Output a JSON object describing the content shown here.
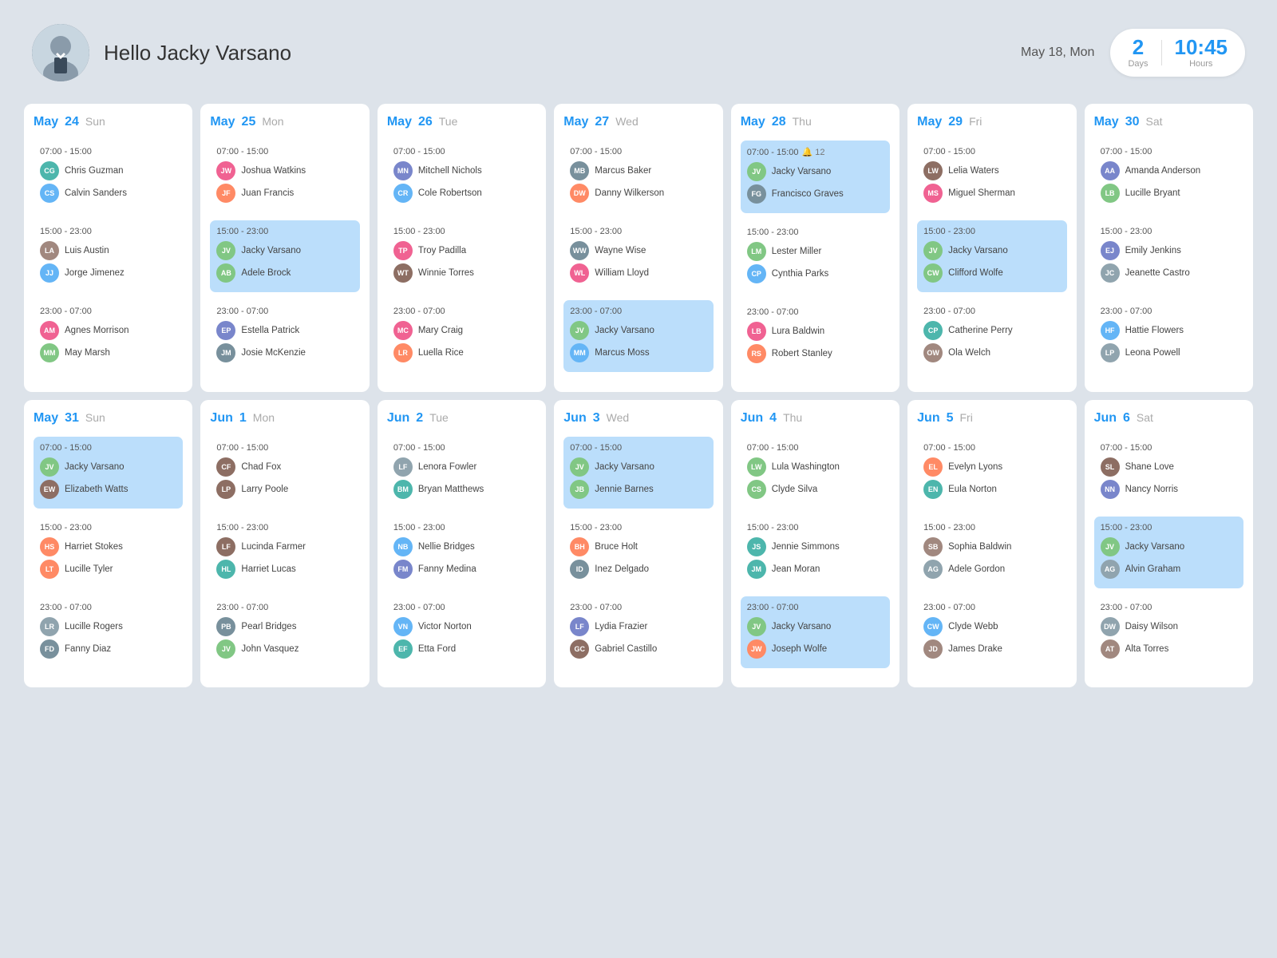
{
  "header": {
    "greeting": "Hello Jacky Varsano",
    "date": "May 18, Mon",
    "days_value": "2",
    "days_label": "Days",
    "hours_value": "10:45",
    "hours_label": "Hours"
  },
  "weeks": [
    {
      "days": [
        {
          "month": "May",
          "num": "24",
          "name": "Sun",
          "shifts": [
            {
              "time": "07:00 - 15:00",
              "highlighted": false,
              "people": [
                "Chris Guzman",
                "Calvin Sanders"
              ]
            },
            {
              "time": "15:00 - 23:00",
              "highlighted": false,
              "people": [
                "Luis Austin",
                "Jorge Jimenez"
              ]
            },
            {
              "time": "23:00 - 07:00",
              "highlighted": false,
              "people": [
                "Agnes Morrison",
                "May Marsh"
              ]
            }
          ]
        },
        {
          "month": "May",
          "num": "25",
          "name": "Mon",
          "shifts": [
            {
              "time": "07:00 - 15:00",
              "highlighted": false,
              "people": [
                "Joshua Watkins",
                "Juan Francis"
              ]
            },
            {
              "time": "15:00 - 23:00",
              "highlighted": true,
              "people": [
                "Jacky Varsano",
                "Adele Brock"
              ]
            },
            {
              "time": "23:00 - 07:00",
              "highlighted": false,
              "people": [
                "Estella Patrick",
                "Josie McKenzie"
              ]
            }
          ]
        },
        {
          "month": "May",
          "num": "26",
          "name": "Tue",
          "shifts": [
            {
              "time": "07:00 - 15:00",
              "highlighted": false,
              "people": [
                "Mitchell Nichols",
                "Cole Robertson"
              ]
            },
            {
              "time": "15:00 - 23:00",
              "highlighted": false,
              "people": [
                "Troy Padilla",
                "Winnie Torres"
              ]
            },
            {
              "time": "23:00 - 07:00",
              "highlighted": false,
              "people": [
                "Mary Craig",
                "Luella Rice"
              ]
            }
          ]
        },
        {
          "month": "May",
          "num": "27",
          "name": "Wed",
          "shifts": [
            {
              "time": "07:00 - 15:00",
              "highlighted": false,
              "people": [
                "Marcus Baker",
                "Danny Wilkerson"
              ]
            },
            {
              "time": "15:00 - 23:00",
              "highlighted": false,
              "people": [
                "Wayne Wise",
                "William Lloyd"
              ]
            },
            {
              "time": "23:00 - 07:00",
              "highlighted": true,
              "people": [
                "Jacky Varsano",
                "Marcus Moss"
              ]
            }
          ]
        },
        {
          "month": "May",
          "num": "28",
          "name": "Thu",
          "shifts": [
            {
              "time": "07:00 - 15:00",
              "highlighted": true,
              "people": [
                "Jacky Varsano",
                "Francisco Graves"
              ],
              "badge": "12"
            },
            {
              "time": "15:00 - 23:00",
              "highlighted": false,
              "people": [
                "Lester Miller",
                "Cynthia Parks"
              ]
            },
            {
              "time": "23:00 - 07:00",
              "highlighted": false,
              "people": [
                "Lura Baldwin",
                "Robert Stanley"
              ]
            }
          ]
        },
        {
          "month": "May",
          "num": "29",
          "name": "Fri",
          "shifts": [
            {
              "time": "07:00 - 15:00",
              "highlighted": false,
              "people": [
                "Lelia Waters",
                "Miguel Sherman"
              ]
            },
            {
              "time": "15:00 - 23:00",
              "highlighted": true,
              "people": [
                "Jacky Varsano",
                "Clifford Wolfe"
              ]
            },
            {
              "time": "23:00 - 07:00",
              "highlighted": false,
              "people": [
                "Catherine Perry",
                "Ola Welch"
              ]
            }
          ]
        },
        {
          "month": "May",
          "num": "30",
          "name": "Sat",
          "shifts": [
            {
              "time": "07:00 - 15:00",
              "highlighted": false,
              "people": [
                "Amanda Anderson",
                "Lucille Bryant"
              ]
            },
            {
              "time": "15:00 - 23:00",
              "highlighted": false,
              "people": [
                "Emily Jenkins",
                "Jeanette Castro"
              ]
            },
            {
              "time": "23:00 - 07:00",
              "highlighted": false,
              "people": [
                "Hattie Flowers",
                "Leona Powell"
              ]
            }
          ]
        }
      ]
    },
    {
      "days": [
        {
          "month": "May",
          "num": "31",
          "name": "Sun",
          "shifts": [
            {
              "time": "07:00 - 15:00",
              "highlighted": true,
              "people": [
                "Jacky Varsano",
                "Elizabeth Watts"
              ]
            },
            {
              "time": "15:00 - 23:00",
              "highlighted": false,
              "people": [
                "Harriet Stokes",
                "Lucille Tyler"
              ]
            },
            {
              "time": "23:00 - 07:00",
              "highlighted": false,
              "people": [
                "Lucille Rogers",
                "Fanny Diaz"
              ]
            }
          ]
        },
        {
          "month": "Jun",
          "num": "1",
          "name": "Mon",
          "shifts": [
            {
              "time": "07:00 - 15:00",
              "highlighted": false,
              "people": [
                "Chad Fox",
                "Larry Poole"
              ]
            },
            {
              "time": "15:00 - 23:00",
              "highlighted": false,
              "people": [
                "Lucinda Farmer",
                "Harriet Lucas"
              ]
            },
            {
              "time": "23:00 - 07:00",
              "highlighted": false,
              "people": [
                "Pearl Bridges",
                "John Vasquez"
              ]
            }
          ]
        },
        {
          "month": "Jun",
          "num": "2",
          "name": "Tue",
          "shifts": [
            {
              "time": "07:00 - 15:00",
              "highlighted": false,
              "people": [
                "Lenora Fowler",
                "Bryan Matthews"
              ]
            },
            {
              "time": "15:00 - 23:00",
              "highlighted": false,
              "people": [
                "Nellie Bridges",
                "Fanny Medina"
              ]
            },
            {
              "time": "23:00 - 07:00",
              "highlighted": false,
              "people": [
                "Victor Norton",
                "Etta Ford"
              ]
            }
          ]
        },
        {
          "month": "Jun",
          "num": "3",
          "name": "Wed",
          "shifts": [
            {
              "time": "07:00 - 15:00",
              "highlighted": true,
              "people": [
                "Jacky Varsano",
                "Jennie Barnes"
              ]
            },
            {
              "time": "15:00 - 23:00",
              "highlighted": false,
              "people": [
                "Bruce Holt",
                "Inez Delgado"
              ]
            },
            {
              "time": "23:00 - 07:00",
              "highlighted": false,
              "people": [
                "Lydia Frazier",
                "Gabriel Castillo"
              ]
            }
          ]
        },
        {
          "month": "Jun",
          "num": "4",
          "name": "Thu",
          "shifts": [
            {
              "time": "07:00 - 15:00",
              "highlighted": false,
              "people": [
                "Lula Washington",
                "Clyde Silva"
              ]
            },
            {
              "time": "15:00 - 23:00",
              "highlighted": false,
              "people": [
                "Jennie Simmons",
                "Jean Moran"
              ]
            },
            {
              "time": "23:00 - 07:00",
              "highlighted": true,
              "people": [
                "Jacky Varsano",
                "Joseph Wolfe"
              ]
            }
          ]
        },
        {
          "month": "Jun",
          "num": "5",
          "name": "Fri",
          "shifts": [
            {
              "time": "07:00 - 15:00",
              "highlighted": false,
              "people": [
                "Evelyn Lyons",
                "Eula Norton"
              ]
            },
            {
              "time": "15:00 - 23:00",
              "highlighted": false,
              "people": [
                "Sophia Baldwin",
                "Adele Gordon"
              ]
            },
            {
              "time": "23:00 - 07:00",
              "highlighted": false,
              "people": [
                "Clyde Webb",
                "James Drake"
              ]
            }
          ]
        },
        {
          "month": "Jun",
          "num": "6",
          "name": "Sat",
          "shifts": [
            {
              "time": "07:00 - 15:00",
              "highlighted": false,
              "people": [
                "Shane Love",
                "Nancy Norris"
              ]
            },
            {
              "time": "15:00 - 23:00",
              "highlighted": true,
              "people": [
                "Jacky Varsano",
                "Alvin Graham"
              ]
            },
            {
              "time": "23:00 - 07:00",
              "highlighted": false,
              "people": [
                "Daisy Wilson",
                "Alta Torres"
              ]
            }
          ]
        }
      ]
    }
  ]
}
